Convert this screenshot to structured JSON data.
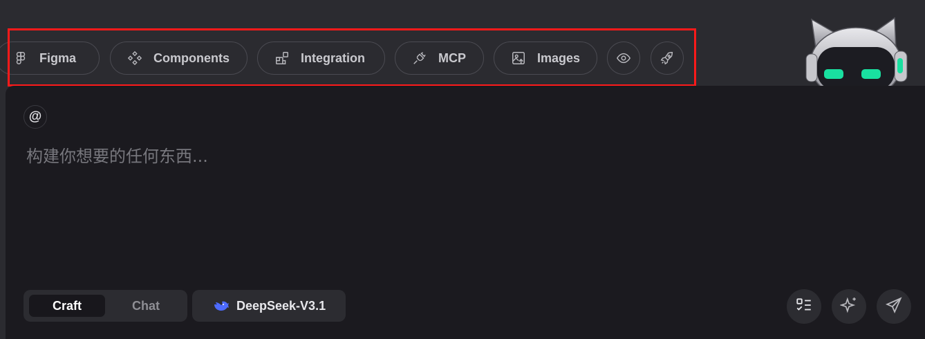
{
  "toolbar": {
    "chips": [
      {
        "label": "Figma",
        "icon": "figma-icon"
      },
      {
        "label": "Components",
        "icon": "components-icon"
      },
      {
        "label": "Integration",
        "icon": "integration-icon"
      },
      {
        "label": "MCP",
        "icon": "plug-icon"
      },
      {
        "label": "Images",
        "icon": "image-icon"
      }
    ],
    "preview_icon": "eye-icon",
    "deploy_icon": "rocket-icon"
  },
  "composer": {
    "mention_symbol": "@",
    "placeholder": "构建你想要的任何东西...",
    "value": ""
  },
  "mode": {
    "options": [
      "Craft",
      "Chat"
    ],
    "selected": "Craft"
  },
  "model": {
    "label": "DeepSeek-V3.1",
    "icon": "deepseek-whale-icon",
    "icon_color": "#4d6bfe"
  },
  "actions": {
    "plan_icon": "checklist-icon",
    "enhance_icon": "sparkle-icon",
    "send_icon": "send-icon"
  },
  "colors": {
    "background": "#2b2b30",
    "panel": "#1b1a1f",
    "highlight": "#ff1a1a",
    "mascot_eyes": "#19e0a0"
  }
}
